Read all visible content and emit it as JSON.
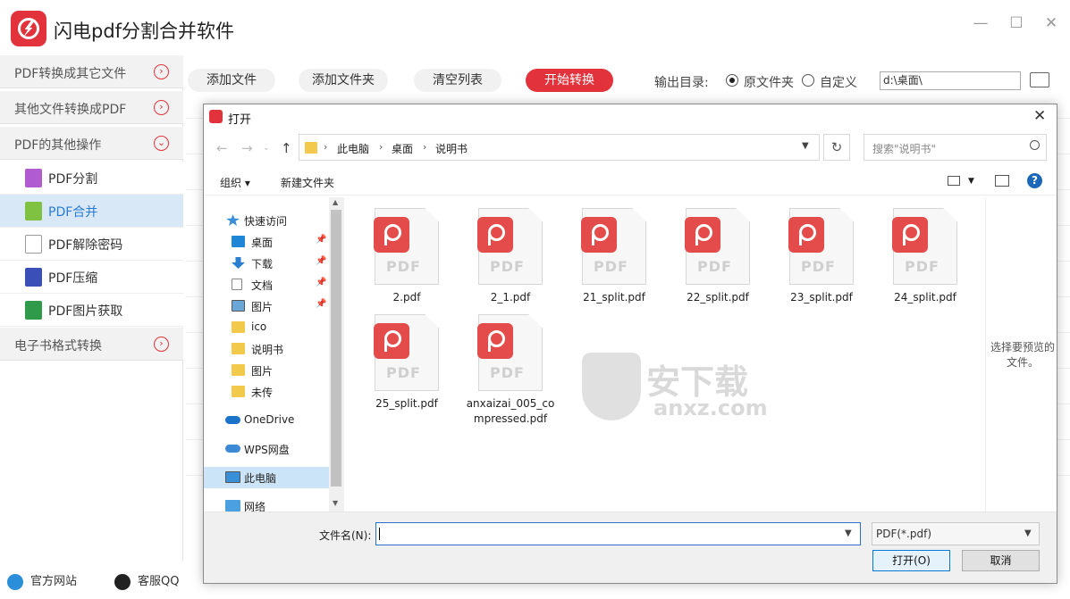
{
  "app": {
    "title": "闪电pdf分割合并软件",
    "minimize": "—",
    "maximize": "☐",
    "close": "✕"
  },
  "sidebar": {
    "sections": [
      {
        "label": "PDF转换成其它文件",
        "icon": "chevron-right-circle"
      },
      {
        "label": "其他文件转换成PDF",
        "icon": "chevron-right-circle"
      },
      {
        "label": "PDF的其他操作",
        "icon": "chevron-down-circle"
      }
    ],
    "items": [
      {
        "label": "PDF分割",
        "icon": "split-icon",
        "color": "#b05bcf"
      },
      {
        "label": "PDF合并",
        "icon": "merge-icon",
        "color": "#7fc241",
        "active": true
      },
      {
        "label": "PDF解除密码",
        "icon": "lock-icon",
        "color": "#9b9b9b"
      },
      {
        "label": "PDF压缩",
        "icon": "compress-icon",
        "color": "#3b4fb8"
      },
      {
        "label": "PDF图片获取",
        "icon": "image-icon",
        "color": "#2e9a4a"
      }
    ],
    "ebook_section": {
      "label": "电子书格式转换",
      "icon": "chevron-right-circle"
    },
    "footer": {
      "website": "官方网站",
      "qq": "客服QQ"
    }
  },
  "toolbar": {
    "add_file": "添加文件",
    "add_folder": "添加文件夹",
    "clear_list": "清空列表",
    "start_convert": "开始转换",
    "output_dir_label": "输出目录:",
    "radio_source": "原文件夹",
    "radio_custom": "自定义",
    "output_path": "d:\\桌面\\"
  },
  "dialog": {
    "title": "打开",
    "close": "✕",
    "breadcrumb": [
      "此电脑",
      "桌面",
      "说明书"
    ],
    "search_placeholder": "搜索\"说明书\"",
    "organize": "组织 ▾",
    "new_folder": "新建文件夹",
    "help": "?",
    "nav": [
      {
        "label": "快速访问",
        "icon": "star-icon",
        "pinned": false
      },
      {
        "label": "桌面",
        "icon": "desktop-icon",
        "pinned": true
      },
      {
        "label": "下载",
        "icon": "download-icon",
        "pinned": true
      },
      {
        "label": "文档",
        "icon": "document-icon",
        "pinned": true
      },
      {
        "label": "图片",
        "icon": "pictures-icon",
        "pinned": true
      },
      {
        "label": "ico",
        "icon": "folder-icon",
        "pinned": false
      },
      {
        "label": "说明书",
        "icon": "folder-icon",
        "pinned": false
      },
      {
        "label": "图片",
        "icon": "folder-icon",
        "pinned": false
      },
      {
        "label": "未传",
        "icon": "folder-icon",
        "pinned": false
      },
      {
        "label": "OneDrive",
        "icon": "cloud-icon",
        "pinned": false
      },
      {
        "label": "WPS网盘",
        "icon": "cloud-icon",
        "pinned": false
      },
      {
        "label": "此电脑",
        "icon": "computer-icon",
        "pinned": false,
        "selected": true
      },
      {
        "label": "网络",
        "icon": "network-icon",
        "pinned": false
      }
    ],
    "files": [
      {
        "name": "2.pdf"
      },
      {
        "name": "2_1.pdf"
      },
      {
        "name": "21_split.pdf"
      },
      {
        "name": "22_split.pdf"
      },
      {
        "name": "23_split.pdf"
      },
      {
        "name": "24_split.pdf"
      },
      {
        "name": "25_split.pdf"
      },
      {
        "name": "anxaizai_005_compressed.pdf"
      }
    ],
    "file_icon_label": "PDF",
    "preview_hint": "选择要预览的文件。",
    "filename_label": "文件名(N):",
    "filename_value": "",
    "filetype": "PDF(*.pdf)",
    "open_button": "打开(O)",
    "cancel_button": "取消"
  },
  "watermark": {
    "text": "安下载",
    "url": "anxz.com"
  },
  "colors": {
    "brand_red": "#e2323b",
    "active_bg": "#d8e8f6",
    "active_text": "#2b7bd0",
    "pdf_badge": "#e44b4b"
  }
}
